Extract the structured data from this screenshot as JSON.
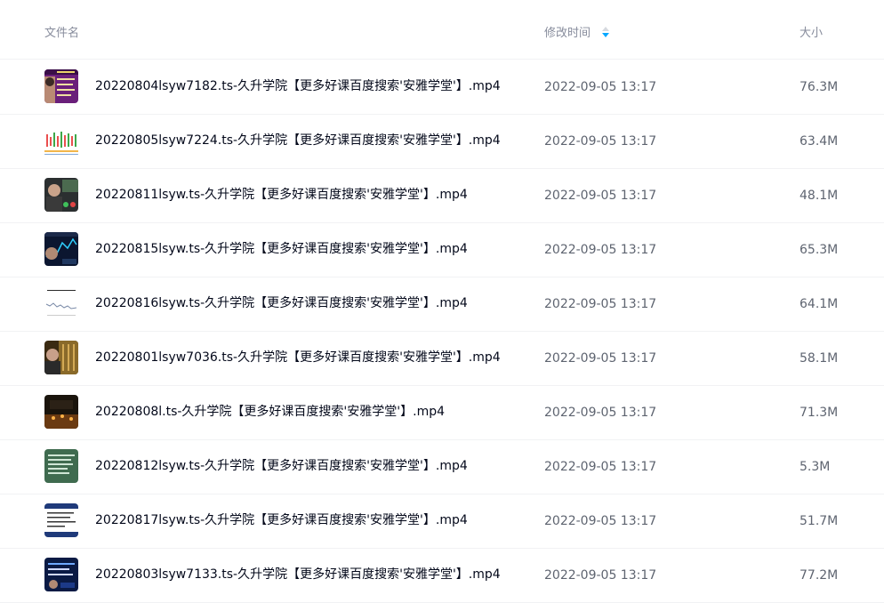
{
  "header": {
    "name_label": "文件名",
    "time_label": "修改时间",
    "size_label": "大小",
    "sort_icon": "sort-arrows-icon"
  },
  "colors": {
    "accent": "#06a7ff",
    "text": "#03081a",
    "muted": "#878c9c",
    "divider": "#f1f2f4"
  },
  "files": [
    {
      "name": "20220804lsyw7182.ts-久升学院【更多好课百度搜索'安雅学堂'】.mp4",
      "time": "2022-09-05 13:17",
      "size": "76.3M",
      "thumb": "purple"
    },
    {
      "name": "20220805lsyw7224.ts-久升学院【更多好课百度搜索'安雅学堂'】.mp4",
      "time": "2022-09-05 13:17",
      "size": "63.4M",
      "thumb": "bars"
    },
    {
      "name": "20220811lsyw.ts-久升学院【更多好课百度搜索'安雅学堂'】.mp4",
      "time": "2022-09-05 13:17",
      "size": "48.1M",
      "thumb": "person"
    },
    {
      "name": "20220815lsyw.ts-久升学院【更多好课百度搜索'安雅学堂'】.mp4",
      "time": "2022-09-05 13:17",
      "size": "65.3M",
      "thumb": "screen"
    },
    {
      "name": "20220816lsyw.ts-久升学院【更多好课百度搜索'安雅学堂'】.mp4",
      "time": "2022-09-05 13:17",
      "size": "64.1M",
      "thumb": "chartline"
    },
    {
      "name": "20220801lsyw7036.ts-久升学院【更多好课百度搜索'安雅学堂'】.mp4",
      "time": "2022-09-05 13:17",
      "size": "58.1M",
      "thumb": "gold"
    },
    {
      "name": "20220808l.ts-久升学院【更多好课百度搜索'安雅学堂'】.mp4",
      "time": "2022-09-05 13:17",
      "size": "71.3M",
      "thumb": "dark"
    },
    {
      "name": "20220812lsyw.ts-久升学院【更多好课百度搜索'安雅学堂'】.mp4",
      "time": "2022-09-05 13:17",
      "size": "5.3M",
      "thumb": "green"
    },
    {
      "name": "20220817lsyw.ts-久升学院【更多好课百度搜索'安雅学堂'】.mp4",
      "time": "2022-09-05 13:17",
      "size": "51.7M",
      "thumb": "doc"
    },
    {
      "name": "20220803lsyw7133.ts-久升学院【更多好课百度搜索'安雅学堂'】.mp4",
      "time": "2022-09-05 13:17",
      "size": "77.2M",
      "thumb": "navy"
    }
  ]
}
